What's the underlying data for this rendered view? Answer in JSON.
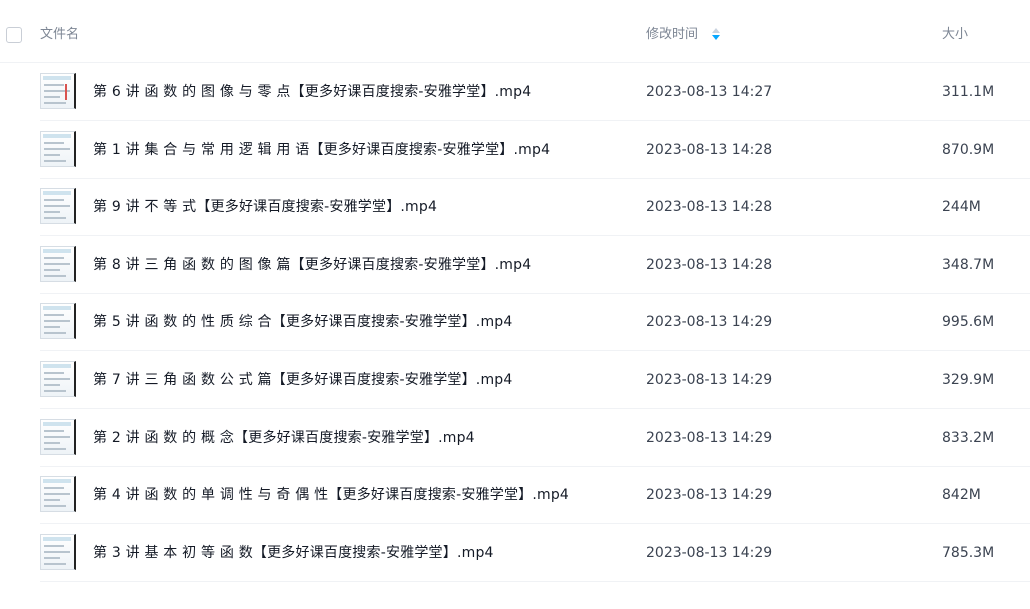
{
  "header": {
    "name_label": "文件名",
    "time_label": "修改时间",
    "size_label": "大小"
  },
  "files": [
    {
      "name": "第 6 讲 函 数 的 图 像 与 零 点【更多好课百度搜索-安雅学堂】.mp4",
      "time": "2023-08-13 14:27",
      "size": "311.1M"
    },
    {
      "name": "第 1 讲 集 合 与 常 用 逻 辑 用 语【更多好课百度搜索-安雅学堂】.mp4",
      "time": "2023-08-13 14:28",
      "size": "870.9M"
    },
    {
      "name": "第 9 讲 不 等 式【更多好课百度搜索-安雅学堂】.mp4",
      "time": "2023-08-13 14:28",
      "size": "244M"
    },
    {
      "name": "第 8 讲 三 角 函 数 的 图 像 篇【更多好课百度搜索-安雅学堂】.mp4",
      "time": "2023-08-13 14:28",
      "size": "348.7M"
    },
    {
      "name": "第 5 讲 函 数 的 性 质 综 合【更多好课百度搜索-安雅学堂】.mp4",
      "time": "2023-08-13 14:29",
      "size": "995.6M"
    },
    {
      "name": "第 7 讲 三 角 函 数 公 式 篇【更多好课百度搜索-安雅学堂】.mp4",
      "time": "2023-08-13 14:29",
      "size": "329.9M"
    },
    {
      "name": "第 2 讲 函 数 的 概 念【更多好课百度搜索-安雅学堂】.mp4",
      "time": "2023-08-13 14:29",
      "size": "833.2M"
    },
    {
      "name": "第 4 讲 函 数 的 单 调 性 与 奇 偶 性【更多好课百度搜索-安雅学堂】.mp4",
      "time": "2023-08-13 14:29",
      "size": "842M"
    },
    {
      "name": "第 3 讲 基 本 初 等 函 数【更多好课百度搜索-安雅学堂】.mp4",
      "time": "2023-08-13 14:29",
      "size": "785.3M"
    }
  ],
  "icons": {
    "select_all": "checkbox-icon",
    "sort": "sort-icon",
    "thumbnail": "video-thumbnail-icon"
  },
  "colors": {
    "sort_accent": "#06a7ff",
    "text": "#141a26",
    "header_text": "#7d8694"
  }
}
